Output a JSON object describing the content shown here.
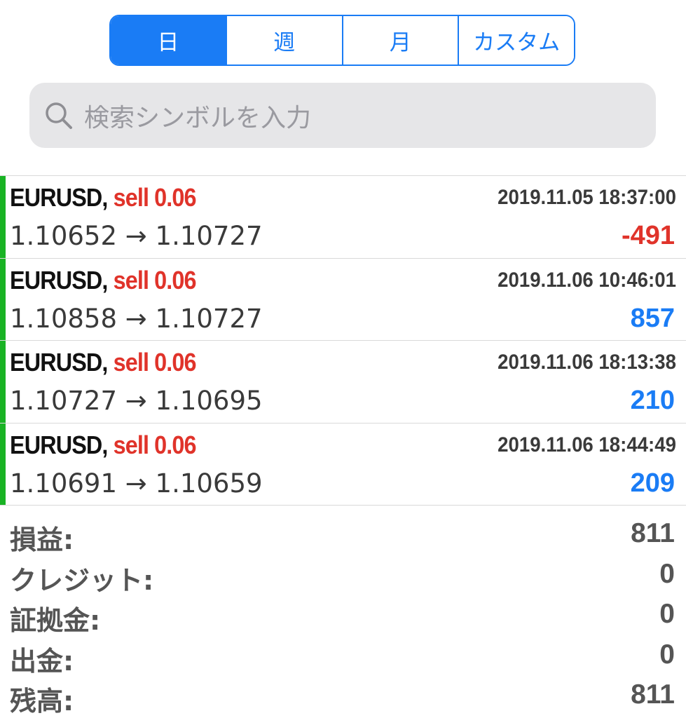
{
  "period_tabs": [
    {
      "label": "日",
      "active": true
    },
    {
      "label": "週",
      "active": false
    },
    {
      "label": "月",
      "active": false
    },
    {
      "label": "カスタム",
      "active": false
    }
  ],
  "search": {
    "placeholder": "検索シンボルを入力"
  },
  "trades": [
    {
      "symbol": "EURUSD,",
      "side": "sell 0.06",
      "time": "2019.11.05 18:37:00",
      "prices": "1.10652 → 1.10727",
      "profit": "-491",
      "profit_sign": "negative"
    },
    {
      "symbol": "EURUSD,",
      "side": "sell 0.06",
      "time": "2019.11.06 10:46:01",
      "prices": "1.10858 → 1.10727",
      "profit": "857",
      "profit_sign": "positive"
    },
    {
      "symbol": "EURUSD,",
      "side": "sell 0.06",
      "time": "2019.11.06 18:13:38",
      "prices": "1.10727 → 1.10695",
      "profit": "210",
      "profit_sign": "positive"
    },
    {
      "symbol": "EURUSD,",
      "side": "sell 0.06",
      "time": "2019.11.06 18:44:49",
      "prices": "1.10691 → 1.10659",
      "profit": "209",
      "profit_sign": "positive"
    }
  ],
  "summary": [
    {
      "label": "損益:",
      "value": "811"
    },
    {
      "label": "クレジット:",
      "value": "0"
    },
    {
      "label": "証拠金:",
      "value": "0"
    },
    {
      "label": "出金:",
      "value": "0"
    },
    {
      "label": "残高:",
      "value": "811"
    }
  ],
  "colors": {
    "accent": "#1a7cf5",
    "sell": "#e0332a",
    "loss": "#e0332a",
    "gain": "#1a7cf5",
    "position_bar": "#19b324"
  }
}
